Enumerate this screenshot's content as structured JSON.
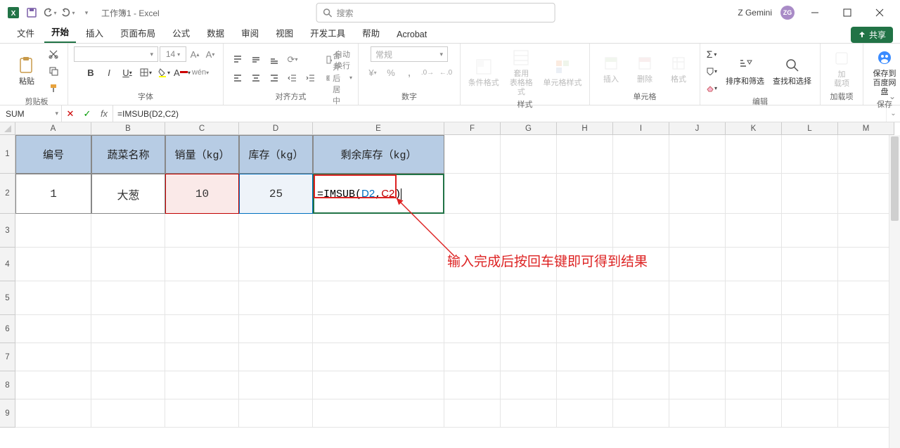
{
  "title": "工作簿1 - Excel",
  "user": {
    "name": "Z Gemini",
    "initials": "ZG"
  },
  "search_placeholder": "搜索",
  "tabs": {
    "file": "文件",
    "home": "开始",
    "insert": "插入",
    "layout": "页面布局",
    "formulas": "公式",
    "data": "数据",
    "review": "审阅",
    "view": "视图",
    "dev": "开发工具",
    "help": "帮助",
    "acrobat": "Acrobat"
  },
  "share": "共享",
  "ribbon": {
    "clipboard": {
      "paste": "粘贴",
      "label": "剪贴板"
    },
    "font": {
      "size": "14",
      "label": "字体",
      "bold": "B",
      "italic": "I",
      "underline": "U"
    },
    "align": {
      "label": "对齐方式",
      "wrap": "自动换行",
      "merge": "合并后居中"
    },
    "number": {
      "label": "数字",
      "format": "常规"
    },
    "styles": {
      "cond": "条件格式",
      "table": "套用\n表格格式",
      "cell": "单元格样式",
      "label": "样式"
    },
    "cells": {
      "insert": "插入",
      "delete": "删除",
      "format": "格式",
      "label": "单元格"
    },
    "editing": {
      "sort": "排序和筛选",
      "find": "查找和选择",
      "label": "编辑"
    },
    "addins": {
      "addin": "加\n载项",
      "label": "加载项"
    },
    "save": {
      "btn": "保存到\n百度网盘",
      "label": "保存"
    }
  },
  "namebox": "SUM",
  "formula": "=IMSUB(D2,C2)",
  "formula_parts": {
    "pre": "=IMSUB(",
    "r1": "D2",
    "comma": ",",
    "r2": "C2",
    "post": ")"
  },
  "columns": [
    {
      "l": "A",
      "w": 108
    },
    {
      "l": "B",
      "w": 105
    },
    {
      "l": "C",
      "w": 105
    },
    {
      "l": "D",
      "w": 105
    },
    {
      "l": "E",
      "w": 187
    },
    {
      "l": "F",
      "w": 80
    },
    {
      "l": "G",
      "w": 80
    },
    {
      "l": "H",
      "w": 80
    },
    {
      "l": "I",
      "w": 80
    },
    {
      "l": "J",
      "w": 80
    },
    {
      "l": "K",
      "w": 80
    },
    {
      "l": "L",
      "w": 80
    },
    {
      "l": "M",
      "w": 80
    }
  ],
  "rows": [
    55,
    57,
    48,
    48,
    48,
    40,
    40,
    40,
    40
  ],
  "headers": {
    "A": "编号",
    "B": "蔬菜名称",
    "C": "销量（kg）",
    "D": "库存（kg）",
    "E": "剩余库存（kg）"
  },
  "data_row": {
    "A": "1",
    "B": "大葱",
    "C": "10",
    "D": "25"
  },
  "annotation": "输入完成后按回车键即可得到结果"
}
